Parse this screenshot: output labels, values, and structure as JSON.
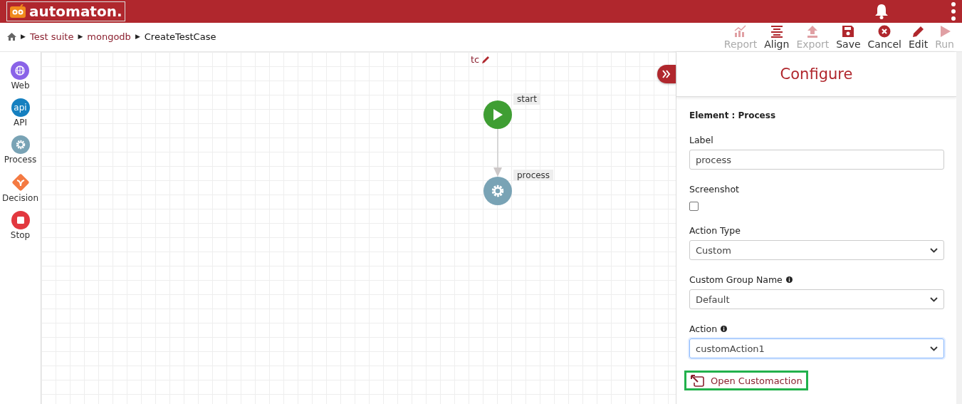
{
  "app": {
    "logo": "automaton."
  },
  "breadcrumb": [
    {
      "separator": "▶",
      "label": "Test suite",
      "kind": "link"
    },
    {
      "separator": "▶",
      "label": "mongodb",
      "kind": "link"
    },
    {
      "separator": "▶",
      "label": "CreateTestCase",
      "kind": "current"
    }
  ],
  "toolbar": [
    {
      "label": "Report",
      "kind": "chart",
      "disabled": true
    },
    {
      "label": "Align",
      "kind": "align",
      "disabled": false
    },
    {
      "label": "Export",
      "kind": "upload",
      "disabled": true
    },
    {
      "label": "Save",
      "kind": "save",
      "disabled": false
    },
    {
      "label": "Cancel",
      "kind": "cancel",
      "disabled": false
    },
    {
      "label": "Edit",
      "kind": "pencil",
      "disabled": false
    },
    {
      "label": "Run",
      "kind": "play",
      "disabled": true
    }
  ],
  "palette": [
    {
      "label": "Web",
      "kind": "web"
    },
    {
      "label": "API",
      "kind": "api",
      "glyph": "api"
    },
    {
      "label": "Process",
      "kind": "process"
    },
    {
      "label": "Decision",
      "kind": "decision"
    },
    {
      "label": "Stop",
      "kind": "stop"
    }
  ],
  "canvas": {
    "title": "tc",
    "nodes": [
      {
        "label": "start",
        "kind": "start"
      },
      {
        "label": "process",
        "kind": "process"
      }
    ]
  },
  "panel": {
    "title": "Configure",
    "element": "Element : Process",
    "fields": [
      {
        "kind": "text",
        "label": "Label",
        "value": "process"
      },
      {
        "kind": "checkbox",
        "label": "Screenshot",
        "checked": false
      },
      {
        "kind": "select",
        "label": "Action Type",
        "value": "Custom",
        "info": false,
        "focused": false
      },
      {
        "kind": "select",
        "label": "Custom Group Name",
        "value": "Default",
        "info": true,
        "focused": false
      },
      {
        "kind": "select",
        "label": "Action",
        "value": "customAction1",
        "info": true,
        "focused": true
      }
    ],
    "link": {
      "label": "Open Customaction",
      "highlighted": true
    }
  }
}
